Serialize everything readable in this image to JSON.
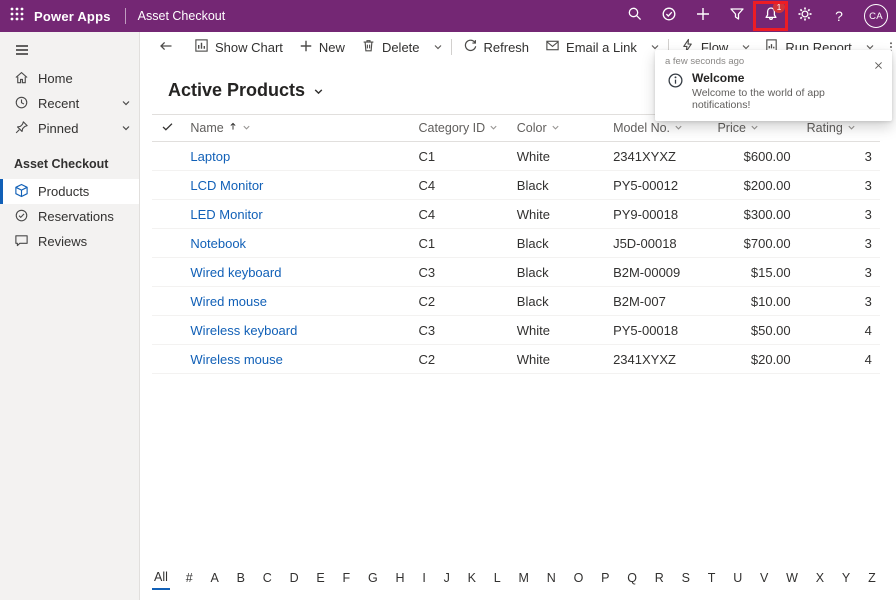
{
  "colors": {
    "accent": "#742774",
    "link": "#1160b7",
    "badge": "#d13438",
    "annotation": "#ed1c24"
  },
  "topbar": {
    "brand": "Power Apps",
    "app": "Asset Checkout",
    "bell_badge": "1",
    "avatar": "CA",
    "icons": [
      "waffle-icon",
      "search-icon",
      "circle-check-icon",
      "plus-icon",
      "filter-icon",
      "bell-icon",
      "gear-icon",
      "help-icon"
    ]
  },
  "sidebar": {
    "home": "Home",
    "recent": "Recent",
    "pinned": "Pinned",
    "group": "Asset Checkout",
    "products": "Products",
    "reservations": "Reservations",
    "reviews": "Reviews"
  },
  "commandbar": {
    "show_chart": "Show Chart",
    "new": "New",
    "delete": "Delete",
    "refresh": "Refresh",
    "email": "Email a Link",
    "flow": "Flow",
    "run_report": "Run Report"
  },
  "toast": {
    "time": "a few seconds ago",
    "title": "Welcome",
    "message": "Welcome to the world of app notifications!"
  },
  "view": {
    "title": "Active Products"
  },
  "table": {
    "headers": {
      "name": "Name",
      "category": "Category ID",
      "color": "Color",
      "model": "Model No.",
      "price": "Price",
      "rating": "Rating"
    },
    "rows": [
      {
        "name": "Laptop",
        "category": "C1",
        "color": "White",
        "model": "2341XYXZ",
        "price": "$600.00",
        "rating": "3"
      },
      {
        "name": "LCD Monitor",
        "category": "C4",
        "color": "Black",
        "model": "PY5-00012",
        "price": "$200.00",
        "rating": "3"
      },
      {
        "name": "LED Monitor",
        "category": "C4",
        "color": "White",
        "model": "PY9-00018",
        "price": "$300.00",
        "rating": "3"
      },
      {
        "name": "Notebook",
        "category": "C1",
        "color": "Black",
        "model": "J5D-00018",
        "price": "$700.00",
        "rating": "3"
      },
      {
        "name": "Wired keyboard",
        "category": "C3",
        "color": "Black",
        "model": "B2M-00009",
        "price": "$15.00",
        "rating": "3"
      },
      {
        "name": "Wired mouse",
        "category": "C2",
        "color": "Black",
        "model": "B2M-007",
        "price": "$10.00",
        "rating": "3"
      },
      {
        "name": "Wireless keyboard",
        "category": "C3",
        "color": "White",
        "model": "PY5-00018",
        "price": "$50.00",
        "rating": "4"
      },
      {
        "name": "Wireless mouse",
        "category": "C2",
        "color": "White",
        "model": "2341XYXZ",
        "price": "$20.00",
        "rating": "4"
      }
    ]
  },
  "jumpbar": [
    "All",
    "#",
    "A",
    "B",
    "C",
    "D",
    "E",
    "F",
    "G",
    "H",
    "I",
    "J",
    "K",
    "L",
    "M",
    "N",
    "O",
    "P",
    "Q",
    "R",
    "S",
    "T",
    "U",
    "V",
    "W",
    "X",
    "Y",
    "Z"
  ]
}
